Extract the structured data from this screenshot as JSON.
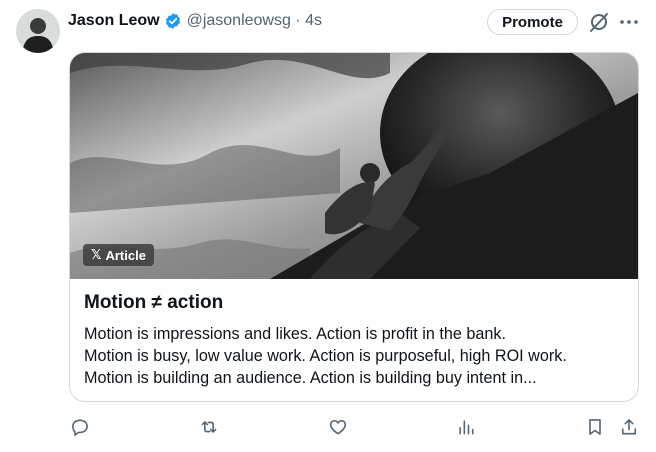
{
  "post": {
    "author_name": "Jason Leow",
    "handle_time": "@jasonleowsg · 4s",
    "promote_label": "Promote"
  },
  "article": {
    "badge": "Article",
    "badge_glyph": "𝕏",
    "title": "Motion ≠ action",
    "lines": [
      "Motion is impressions and likes. Action is profit in the bank.",
      "Motion is busy, low value work. Action is purposeful, high ROI work.",
      "Motion is building an audience. Action is building buy intent in..."
    ]
  },
  "icons": {
    "verified": "verified-badge-icon",
    "grok": "grok-icon",
    "more": "more-icon",
    "reply": "reply-icon",
    "repost": "repost-icon",
    "like": "like-icon",
    "views": "views-icon",
    "bookmark": "bookmark-icon",
    "share": "share-icon"
  },
  "colors": {
    "text": "#0f1419",
    "secondary": "#536471",
    "verified": "#1d9bf0",
    "border": "#cfd9de"
  }
}
